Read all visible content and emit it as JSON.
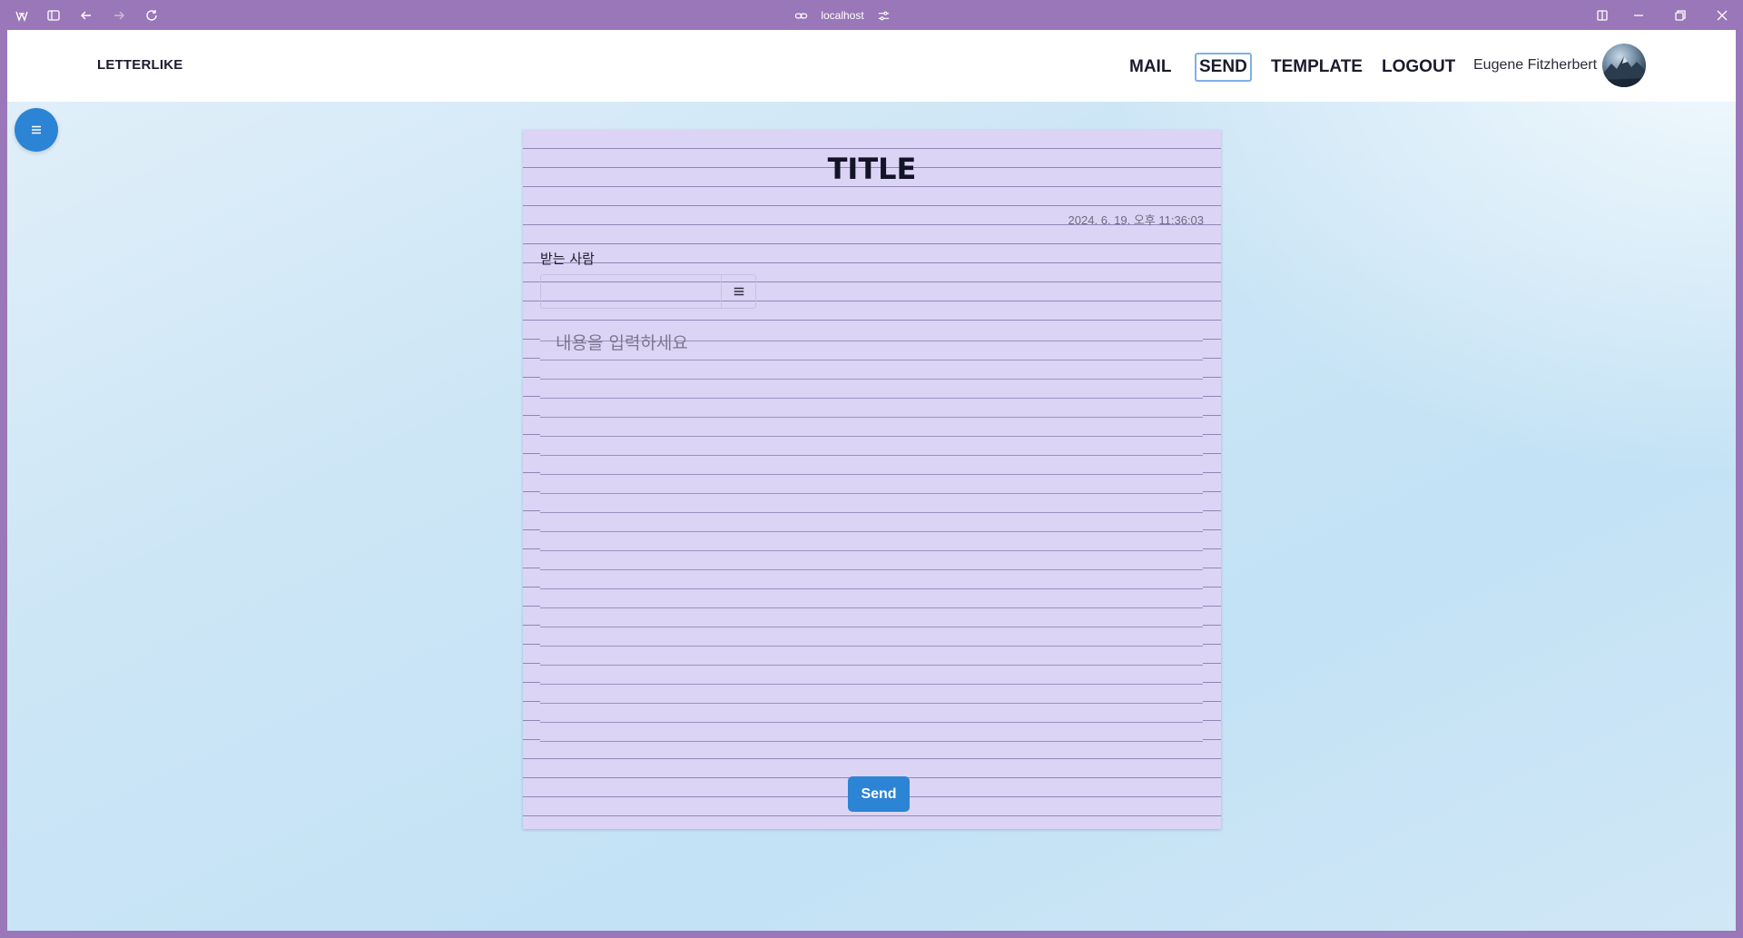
{
  "browser": {
    "url": "localhost"
  },
  "navbar": {
    "brand": "LETTERLIKE",
    "links": [
      {
        "label": "MAIL"
      },
      {
        "label": "SEND"
      },
      {
        "label": "TEMPLATE"
      },
      {
        "label": "LOGOUT"
      }
    ],
    "active_link": "SEND",
    "username": "Eugene Fitzherbert"
  },
  "letter": {
    "title": "TITLE",
    "date": "2024. 6. 19. 오후 11:36:03",
    "recipient_label": "받는 사람",
    "recipient_value": "",
    "content_placeholder": "내용을 입력하세요",
    "send_label": "Send"
  },
  "colors": {
    "chrome": "#9a77b8",
    "paper": "#dcd4f4",
    "accent": "#2c84d4"
  },
  "icons": {
    "fab": "menu-icon",
    "recipient_button": "menu-icon"
  }
}
